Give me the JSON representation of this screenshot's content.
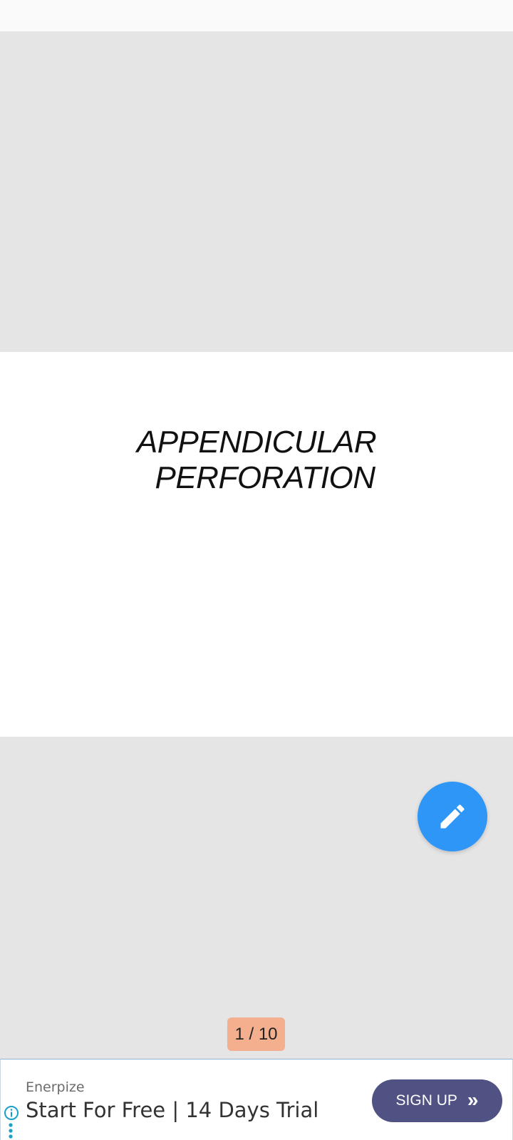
{
  "slide": {
    "title_line1": "APPENDICULAR",
    "title_line2": "PERFORATION"
  },
  "fab": {
    "icon": "pencil-icon",
    "color": "#2e96f7"
  },
  "pager": {
    "label": "1 / 10"
  },
  "ad": {
    "brand": "Enerpize",
    "headline": "Start For Free | 14 Days Trial",
    "cta_label": "SIGN UP",
    "cta_icon": "double-chevron-right-icon",
    "info_icon": "info-icon",
    "more_icon": "more-vertical-icon",
    "cta_color": "#4f5283",
    "icon_color": "#1aa0c8"
  }
}
